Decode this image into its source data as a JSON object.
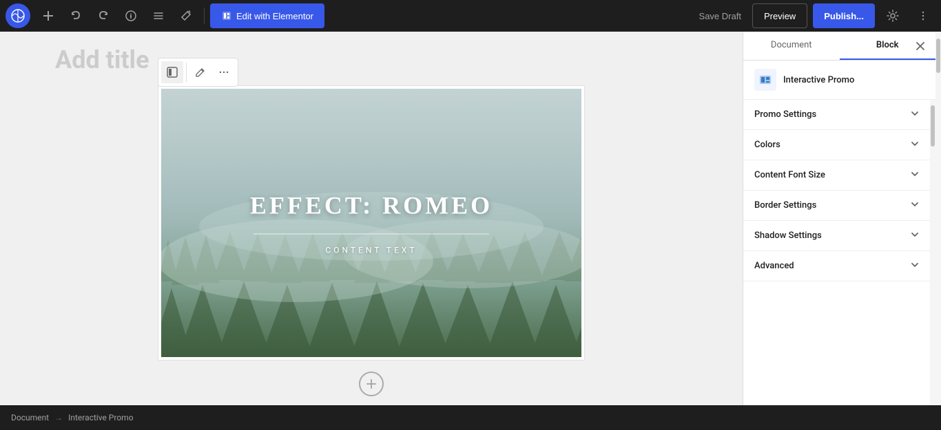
{
  "toolbar": {
    "add_label": "+",
    "undo_label": "↩",
    "redo_label": "↪",
    "info_label": "ℹ",
    "list_label": "≡",
    "pencil_label": "✏",
    "elementor_btn_label": "Edit with Elementor",
    "save_draft_label": "Save Draft",
    "preview_label": "Preview",
    "publish_label": "Publish...",
    "settings_label": "⚙",
    "more_label": "⋮"
  },
  "page": {
    "title_placeholder": "Add title"
  },
  "promo_block": {
    "title": "EFFECT:  ROMEO",
    "subtitle": "CONTENT TEXT"
  },
  "block_toolbar": {
    "select_icon": "⊞",
    "edit_icon": "✏",
    "more_icon": "⋮"
  },
  "sidebar": {
    "tab_document": "Document",
    "tab_block": "Block",
    "active_tab": "block",
    "block_info": {
      "name": "Interactive Promo"
    },
    "sections": [
      {
        "id": "promo-settings",
        "label": "Promo Settings",
        "open": false
      },
      {
        "id": "colors",
        "label": "Colors",
        "open": false
      },
      {
        "id": "content-font-size",
        "label": "Content Font Size",
        "open": false
      },
      {
        "id": "border-settings",
        "label": "Border Settings",
        "open": false
      },
      {
        "id": "shadow-settings",
        "label": "Shadow Settings",
        "open": false
      },
      {
        "id": "advanced",
        "label": "Advanced",
        "open": false
      }
    ]
  },
  "breadcrumb": {
    "root": "Document",
    "separator": "→",
    "current": "Interactive Promo"
  },
  "colors": {
    "toolbar_bg": "#1e1e1e",
    "accent_blue": "#3858e9",
    "sidebar_bg": "#ffffff",
    "border": "#dddddd"
  }
}
